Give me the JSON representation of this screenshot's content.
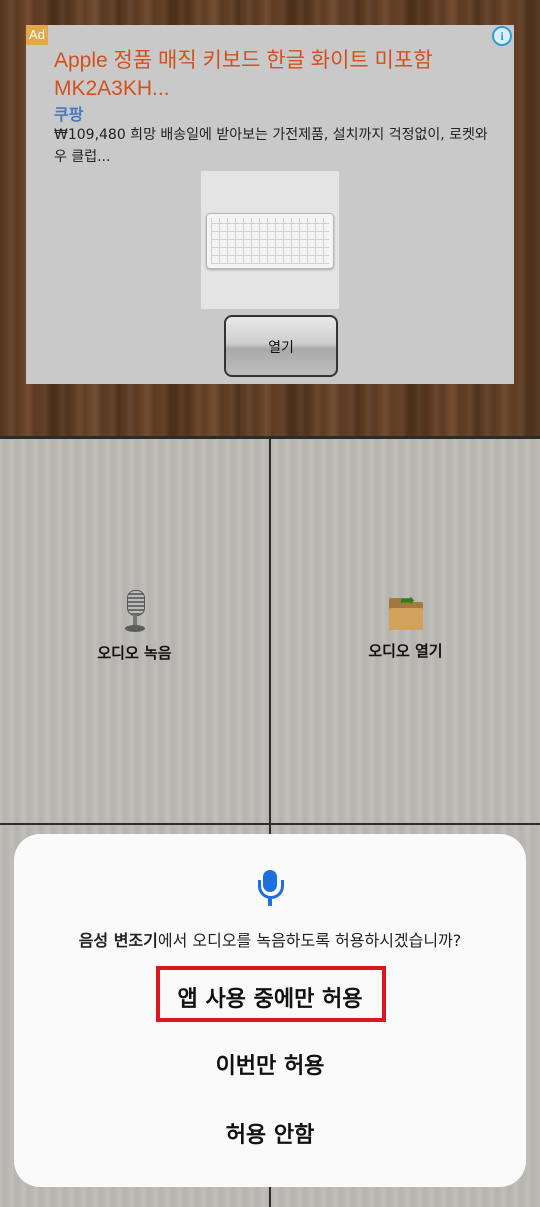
{
  "ad": {
    "badge": "Ad",
    "info_icon": "info-icon",
    "title": "Apple 정품 매직 키보드 한글 화이트 미포함 MK2A3KH...",
    "brand": "쿠팡",
    "description": "₩109,480 희망 배송일에 받아보는 가전제품, 설치까지 걱정없이, 로켓와우 클럽...",
    "button_label": "열기"
  },
  "tiles": [
    {
      "label": "오디오 녹음",
      "icon": "microphone-icon"
    },
    {
      "label": "오디오 열기",
      "icon": "folder-open-icon"
    }
  ],
  "dialog": {
    "icon": "microphone-icon",
    "app_name": "음성 변조기",
    "message_suffix": "에서 오디오를 녹음하도록 허용하시겠습니까?",
    "options": [
      {
        "label": "앱 사용 중에만 허용"
      },
      {
        "label": "이번만 허용"
      },
      {
        "label": "허용 안함"
      }
    ],
    "highlight_color": "#e0161e",
    "accent_color": "#1e6fe0"
  }
}
